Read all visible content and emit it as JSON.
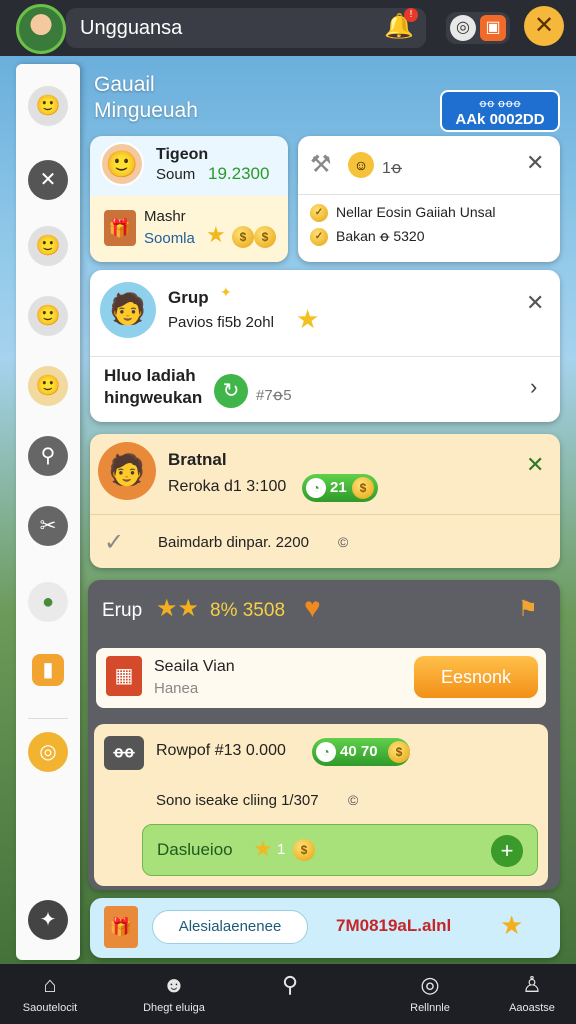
{
  "topbar": {
    "title": "Ungguansa",
    "bell_badge": "!"
  },
  "sidebar": {
    "icons": [
      "avatar",
      "close-icon",
      "avatar",
      "avatar",
      "avatar",
      "search-icon",
      "tools-icon",
      "chat-icon",
      "badge-icon",
      "coin-icon",
      "settings-icon"
    ]
  },
  "header": {
    "title_line1": "Gauail",
    "title_line2": "Mingueuah"
  },
  "promo_badge": {
    "line1": "ꝋꝋ   ꝋꝋꝋ",
    "line2": "AAk 0002DD"
  },
  "card_profile": {
    "name": "Tigeon",
    "label": "Soum",
    "value": "19.2300",
    "sub_title": "Mashr",
    "sub_label": "Soomla"
  },
  "card_info": {
    "count": "1ꝋ",
    "line1": "Nellar Eosin Gaiiah Unsal",
    "line2": "Bakan ꝋ 5320"
  },
  "card_grup": {
    "title": "Grup",
    "subtitle": "Pavios fi5b 2ohl",
    "row_label_1": "Hluo ladiah",
    "row_label_2": "hingweukan",
    "row_value": "#7ꝋ5"
  },
  "card_bratnal": {
    "title": "Bratnal",
    "subtitle": "Reroka d1 3:100",
    "pill_value": "21",
    "footer_text": "Baimdarb dinpar. 2200"
  },
  "card_erup": {
    "title": "Erup",
    "stats": "8% 3508",
    "item_title": "Seaila Vian",
    "item_subtitle": "Hanea",
    "item_button": "Eesnonk",
    "row_icon": "ꝋꝋ",
    "row_text": "Rowpof #13 0.000",
    "row_pill": "40 70",
    "row2_text": "Sono iseake cliing 1/307",
    "action_label": "Daslueioo",
    "action_value": "1"
  },
  "card_bottom": {
    "input_label": "Alesialaenenee",
    "value_text": "7M0819aL.alnl"
  },
  "bottom_nav": [
    {
      "label": "Saoutelocit"
    },
    {
      "label": "Dhegt eluiga"
    },
    {
      "label": ""
    },
    {
      "label": "Rellnnle"
    },
    {
      "label": "Aaoastse"
    }
  ]
}
